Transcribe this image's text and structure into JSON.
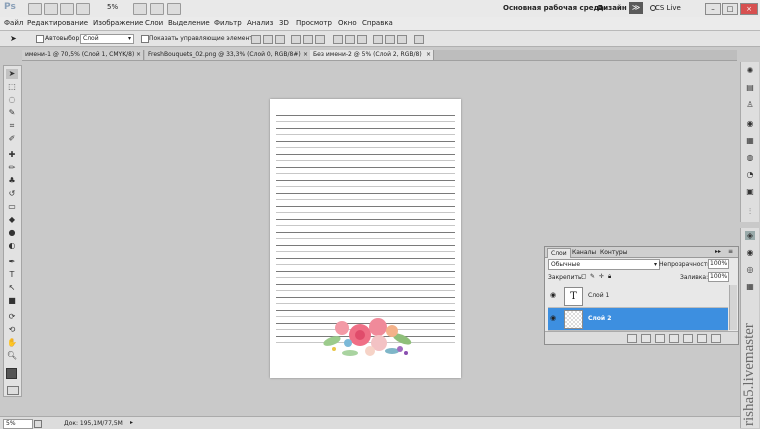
{
  "appbar": {
    "logo": "Ps",
    "zoom": "5%",
    "workspace": "Основная рабочая среда",
    "design": "Дизайн",
    "more": "≫",
    "cs_live": "CS Live",
    "cs_live_icon": "cs-live-icon"
  },
  "menu": {
    "items": [
      "Файл",
      "Редактирование",
      "Изображение",
      "Слои",
      "Выделение",
      "Фильтр",
      "Анализ",
      "3D",
      "Просмотр",
      "Окно",
      "Справка"
    ]
  },
  "options": {
    "autoselect_label": "Автовыбор:",
    "autoselect_value": "Слой",
    "show_controls_label": "Показать управляющие элементы"
  },
  "tabs": [
    {
      "label": "имени-1 @ 70,5% (Слой 1, CMYK/8)",
      "close": "×"
    },
    {
      "label": "FreshBouquets_02.png @ 33,3% (Слой 0, RGB/8#)",
      "close": "×"
    },
    {
      "label": "Без имени-2 @ 5% (Слой 2, RGB/8)",
      "close": "×"
    }
  ],
  "layers_panel": {
    "tabs": [
      "Слои",
      "Каналы",
      "Контуры"
    ],
    "blend_mode": "Обычные",
    "opacity_label": "Непрозрачность:",
    "opacity_value": "100%",
    "lock_label": "Закрепить:",
    "fill_label": "Заливка:",
    "fill_value": "100%",
    "layers": [
      {
        "name": "Слой 1",
        "type": "text",
        "thumb": "T",
        "selected": false
      },
      {
        "name": "Слой 2",
        "type": "image",
        "selected": true
      }
    ]
  },
  "status": {
    "zoom": "5%",
    "doc_info": "Док: 195,1M/77,5M"
  },
  "watermark": "risha5.livemaster",
  "colors": {
    "selection": "#3d8fe0",
    "canvas_bg": "#c9c9c9"
  }
}
